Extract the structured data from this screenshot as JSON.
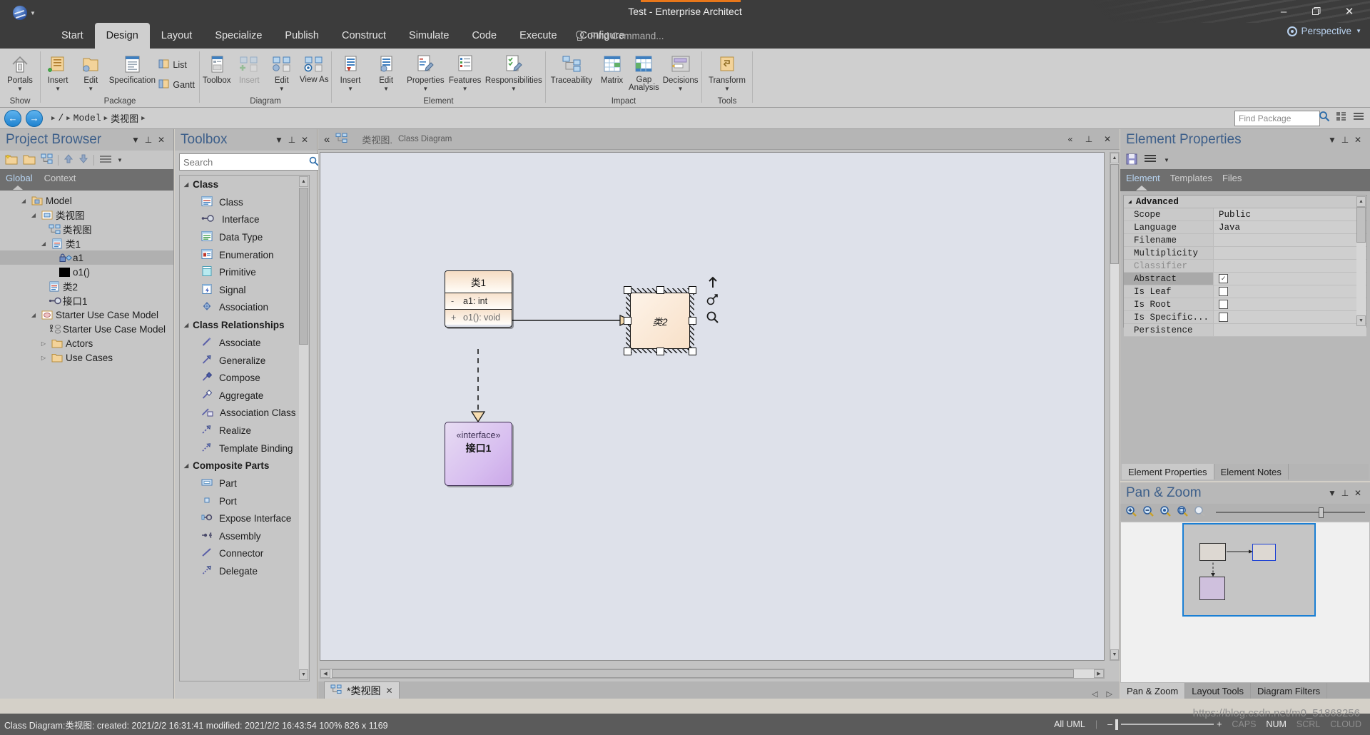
{
  "window": {
    "title": "Test - Enterprise Architect",
    "minimize": "–",
    "restore": "❐",
    "close": "✕",
    "perspective": "Perspective"
  },
  "menu": {
    "tabs": [
      {
        "label": "Start",
        "active": false
      },
      {
        "label": "Design",
        "active": true
      },
      {
        "label": "Layout",
        "active": false
      },
      {
        "label": "Specialize",
        "active": false
      },
      {
        "label": "Publish",
        "active": false
      },
      {
        "label": "Construct",
        "active": false
      },
      {
        "label": "Simulate",
        "active": false
      },
      {
        "label": "Code",
        "active": false
      },
      {
        "label": "Execute",
        "active": false
      },
      {
        "label": "Configure",
        "active": false
      }
    ],
    "find_command_placeholder": "Find Command..."
  },
  "ribbon": {
    "groups": [
      {
        "name": "Show",
        "buttons": [
          {
            "label": "Portals",
            "caret": true,
            "disabled": false
          }
        ]
      },
      {
        "name": "Package",
        "buttons": [
          {
            "label": "Insert",
            "caret": true,
            "disabled": false
          },
          {
            "label": "Edit",
            "caret": true,
            "disabled": false
          },
          {
            "label": "Specification",
            "caret": false,
            "disabled": false
          }
        ],
        "small_buttons": [
          {
            "label": "List"
          },
          {
            "label": "Gantt"
          }
        ]
      },
      {
        "name": "Diagram",
        "buttons": [
          {
            "label": "Toolbox",
            "caret": false,
            "disabled": false
          },
          {
            "label": "Insert",
            "caret": false,
            "disabled": true
          },
          {
            "label": "Edit",
            "caret": true,
            "disabled": false
          },
          {
            "label": "View As",
            "caret": true,
            "disabled": false
          }
        ]
      },
      {
        "name": "Element",
        "buttons": [
          {
            "label": "Insert",
            "caret": true,
            "disabled": false
          },
          {
            "label": "Edit",
            "caret": true,
            "disabled": false
          },
          {
            "label": "Properties",
            "caret": true,
            "disabled": false
          },
          {
            "label": "Features",
            "caret": true,
            "disabled": false
          },
          {
            "label": "Responsibilities",
            "caret": true,
            "disabled": false
          }
        ]
      },
      {
        "name": "Impact",
        "buttons": [
          {
            "label": "Traceability",
            "caret": false,
            "disabled": false
          },
          {
            "label": "Matrix",
            "caret": false,
            "disabled": false
          },
          {
            "label": "Gap Analysis",
            "caret": false,
            "disabled": false
          },
          {
            "label": "Decisions",
            "caret": true,
            "disabled": false
          }
        ]
      },
      {
        "name": "Tools",
        "buttons": [
          {
            "label": "Transform",
            "caret": true,
            "disabled": false
          }
        ]
      }
    ]
  },
  "breadcrumb": {
    "back": "←",
    "forward": "→",
    "items": [
      "/",
      "Model",
      "类视图"
    ],
    "find_package_placeholder": "Find Package"
  },
  "browser": {
    "title": "Project Browser",
    "tabs": [
      {
        "label": "Global",
        "active": true
      },
      {
        "label": "Context",
        "active": false
      }
    ],
    "tree": [
      {
        "label": "Model",
        "depth": 0,
        "twisty": "◢",
        "icon": "model-folder-icon",
        "selected": false
      },
      {
        "label": "类视图",
        "depth": 1,
        "twisty": "◢",
        "icon": "view-package-icon",
        "selected": false
      },
      {
        "label": "类视图",
        "depth": 2,
        "twisty": "",
        "icon": "class-diagram-icon",
        "selected": false
      },
      {
        "label": "类1",
        "depth": 2,
        "twisty": "◢",
        "icon": "class-icon",
        "selected": false
      },
      {
        "label": "a1",
        "depth": 3,
        "twisty": "",
        "icon": "attribute-private-icon",
        "selected": true
      },
      {
        "label": "o1()",
        "depth": 3,
        "twisty": "",
        "icon": "operation-icon",
        "selected": false
      },
      {
        "label": "类2",
        "depth": 2,
        "twisty": "",
        "icon": "class-icon",
        "selected": false
      },
      {
        "label": "接口1",
        "depth": 2,
        "twisty": "",
        "icon": "interface-icon",
        "selected": false
      },
      {
        "label": "Starter Use Case Model",
        "depth": 1,
        "twisty": "◢",
        "icon": "usecase-package-icon",
        "selected": false
      },
      {
        "label": "Starter Use Case Model",
        "depth": 2,
        "twisty": "",
        "icon": "usecase-diagram-icon",
        "selected": false
      },
      {
        "label": "Actors",
        "depth": 2,
        "twisty": "▷",
        "icon": "folder-icon",
        "selected": false
      },
      {
        "label": "Use Cases",
        "depth": 2,
        "twisty": "▷",
        "icon": "folder-icon",
        "selected": false
      }
    ]
  },
  "toolbox": {
    "title": "Toolbox",
    "search_placeholder": "Search",
    "groups": [
      {
        "name": "Class",
        "items": [
          {
            "label": "Class",
            "icon": "class-icon"
          },
          {
            "label": "Interface",
            "icon": "interface-icon"
          },
          {
            "label": "Data Type",
            "icon": "datatype-icon"
          },
          {
            "label": "Enumeration",
            "icon": "enumeration-icon"
          },
          {
            "label": "Primitive",
            "icon": "primitive-icon"
          },
          {
            "label": "Signal",
            "icon": "signal-icon"
          },
          {
            "label": "Association",
            "icon": "association-icon"
          }
        ]
      },
      {
        "name": "Class Relationships",
        "items": [
          {
            "label": "Associate",
            "icon": "associate-icon"
          },
          {
            "label": "Generalize",
            "icon": "generalize-icon"
          },
          {
            "label": "Compose",
            "icon": "compose-icon"
          },
          {
            "label": "Aggregate",
            "icon": "aggregate-icon"
          },
          {
            "label": "Association Class",
            "icon": "association-class-icon"
          },
          {
            "label": "Realize",
            "icon": "realize-icon"
          },
          {
            "label": "Template Binding",
            "icon": "template-binding-icon"
          }
        ]
      },
      {
        "name": "Composite Parts",
        "items": [
          {
            "label": "Part",
            "icon": "part-icon"
          },
          {
            "label": "Port",
            "icon": "port-icon"
          },
          {
            "label": "Expose Interface",
            "icon": "expose-interface-icon"
          },
          {
            "label": "Assembly",
            "icon": "assembly-icon"
          },
          {
            "label": "Connector",
            "icon": "connector-icon"
          },
          {
            "label": "Delegate",
            "icon": "delegate-icon"
          }
        ]
      }
    ]
  },
  "diagram": {
    "header_name": "类视图.",
    "header_type": "Class Diagram",
    "collapse": "«",
    "elements": {
      "class1": {
        "name": "类1",
        "attributes": [
          {
            "visibility": "-",
            "text": "a1: int"
          }
        ],
        "operations": [
          {
            "visibility": "+",
            "text": "o1(): void"
          }
        ]
      },
      "class2": {
        "name": "类2",
        "selected": true
      },
      "interface1": {
        "stereotype": "«interface»",
        "name": "接口1"
      }
    }
  },
  "element_properties": {
    "title": "Element Properties",
    "tabs": [
      {
        "label": "Element",
        "active": true
      },
      {
        "label": "Templates",
        "active": false
      },
      {
        "label": "Files",
        "active": false
      }
    ],
    "category": "Advanced",
    "rows": [
      {
        "key": "Scope",
        "value": "Public",
        "type": "text",
        "dim": false,
        "highlight": false
      },
      {
        "key": "Language",
        "value": "Java",
        "type": "text",
        "dim": false,
        "highlight": false
      },
      {
        "key": "Filename",
        "value": "",
        "type": "text",
        "dim": false,
        "highlight": false
      },
      {
        "key": "Multiplicity",
        "value": "",
        "type": "text",
        "dim": false,
        "highlight": false
      },
      {
        "key": "Classifier",
        "value": "",
        "type": "text",
        "dim": true,
        "highlight": false
      },
      {
        "key": "Abstract",
        "value": "",
        "type": "checkbox",
        "checked": true,
        "dim": false,
        "highlight": true
      },
      {
        "key": "Is Leaf",
        "value": "",
        "type": "checkbox",
        "checked": false,
        "dim": false,
        "highlight": false
      },
      {
        "key": "Is Root",
        "value": "",
        "type": "checkbox",
        "checked": false,
        "dim": false,
        "highlight": false
      },
      {
        "key": "Is Specific...",
        "value": "",
        "type": "checkbox",
        "checked": false,
        "dim": false,
        "highlight": false
      },
      {
        "key": "Persistence",
        "value": "",
        "type": "text",
        "dim": false,
        "highlight": false
      }
    ],
    "bottom_tabs": [
      {
        "label": "Element Properties",
        "active": true
      },
      {
        "label": "Element Notes",
        "active": false
      }
    ]
  },
  "pan_zoom": {
    "title": "Pan & Zoom",
    "tools": [
      "zoom-in-icon",
      "zoom-out-icon",
      "zoom-fit-icon",
      "zoom-selection-icon",
      "zoom-normal-icon"
    ],
    "bottom_tabs": [
      {
        "label": "Pan & Zoom",
        "active": true
      },
      {
        "label": "Layout Tools",
        "active": false
      },
      {
        "label": "Diagram Filters",
        "active": false
      }
    ]
  },
  "doc_tabs": [
    {
      "label": "*类视图",
      "close": "✕",
      "active": true
    }
  ],
  "status_bar": {
    "text": "Class Diagram:类视图:   created: 2021/2/2 16:31:41  modified: 2021/2/2 16:43:54   100%   826 x 1169",
    "uml_mode": "All UML",
    "zoom_minus": "–",
    "zoom_plus": "+",
    "indicators": [
      {
        "label": "CAPS",
        "on": false
      },
      {
        "label": "NUM",
        "on": true
      },
      {
        "label": "SCRL",
        "on": false
      },
      {
        "label": "CLOUD",
        "on": false
      }
    ]
  },
  "watermark": "https://blog.csdn.net/m0_51868256"
}
